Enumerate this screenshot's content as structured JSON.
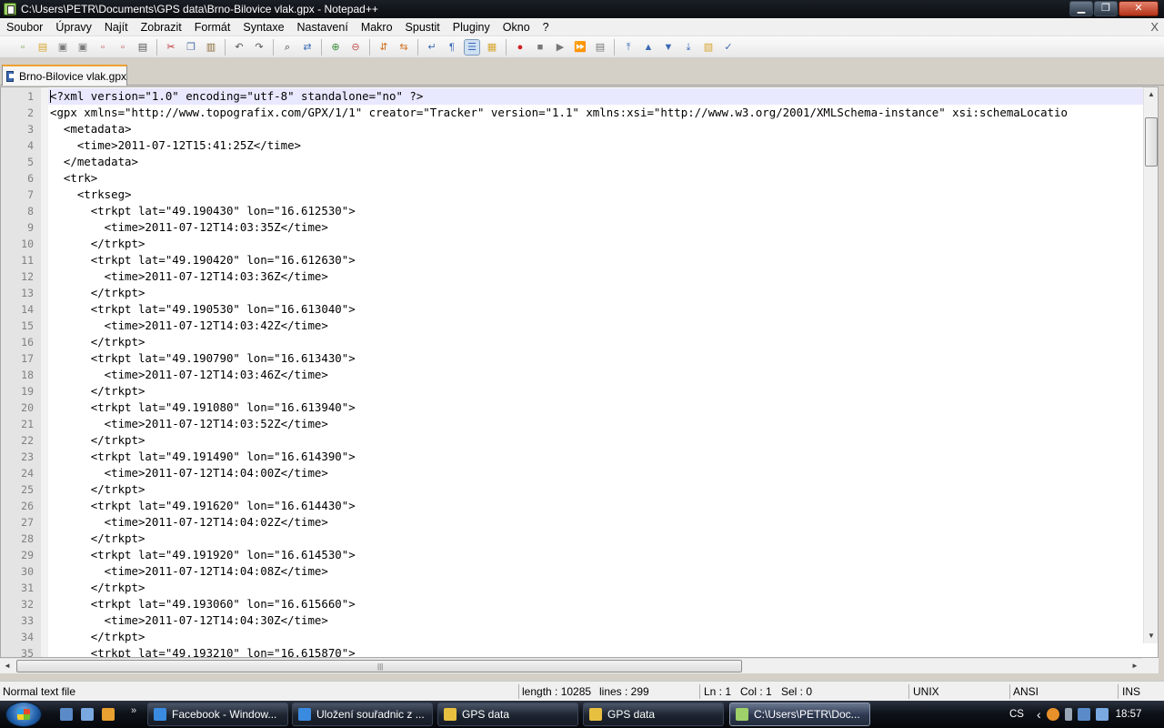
{
  "window": {
    "title": "C:\\Users\\PETR\\Documents\\GPS data\\Brno-Bilovice vlak.gpx - Notepad++",
    "app_icon": "notepadpp-icon",
    "buttons": {
      "minimize": "▁",
      "maximize": "❐",
      "close": "✕"
    }
  },
  "menu": {
    "items": [
      "Soubor",
      "Úpravy",
      "Najít",
      "Zobrazit",
      "Formát",
      "Syntaxe",
      "Nastavení",
      "Makro",
      "Spustit",
      "Pluginy",
      "Okno",
      "?"
    ],
    "close_glyph": "X"
  },
  "toolbar": {
    "icons": [
      {
        "name": "new-file-icon",
        "glyph": "▫",
        "color": "#6a9b3a"
      },
      {
        "name": "open-file-icon",
        "glyph": "▤",
        "color": "#d8a630"
      },
      {
        "name": "save-icon",
        "glyph": "▣",
        "color": "#7a7a7a"
      },
      {
        "name": "save-all-icon",
        "glyph": "▣",
        "color": "#7a7a7a"
      },
      {
        "name": "close-file-icon",
        "glyph": "▫",
        "color": "#c05050"
      },
      {
        "name": "close-all-icon",
        "glyph": "▫",
        "color": "#c05050"
      },
      {
        "name": "print-icon",
        "glyph": "▤",
        "color": "#555555"
      },
      {
        "sep": true
      },
      {
        "name": "cut-icon",
        "glyph": "✂",
        "color": "#c03030"
      },
      {
        "name": "copy-icon",
        "glyph": "❐",
        "color": "#4a6fa5"
      },
      {
        "name": "paste-icon",
        "glyph": "▥",
        "color": "#8a6a3a"
      },
      {
        "sep": true
      },
      {
        "name": "undo-icon",
        "glyph": "↶",
        "color": "#555555"
      },
      {
        "name": "redo-icon",
        "glyph": "↷",
        "color": "#555555"
      },
      {
        "sep": true
      },
      {
        "name": "find-icon",
        "glyph": "⌕",
        "color": "#333333"
      },
      {
        "name": "replace-icon",
        "glyph": "⇄",
        "color": "#3a6ab5"
      },
      {
        "sep": true
      },
      {
        "name": "zoom-in-icon",
        "glyph": "⊕",
        "color": "#3a8a3a"
      },
      {
        "name": "zoom-out-icon",
        "glyph": "⊖",
        "color": "#c05050"
      },
      {
        "sep": true
      },
      {
        "name": "sync-vertical-icon",
        "glyph": "⇵",
        "color": "#d07020"
      },
      {
        "name": "sync-horizontal-icon",
        "glyph": "⇆",
        "color": "#d07020"
      },
      {
        "sep": true
      },
      {
        "name": "word-wrap-icon",
        "glyph": "↵",
        "color": "#3a6ab5"
      },
      {
        "name": "show-all-chars-icon",
        "glyph": "¶",
        "color": "#3a6ab5"
      },
      {
        "name": "indent-guide-icon",
        "glyph": "☰",
        "color": "#3a6ab5",
        "pressed": true
      },
      {
        "name": "user-language-icon",
        "glyph": "▦",
        "color": "#d8a630"
      },
      {
        "sep": true
      },
      {
        "name": "record-macro-icon",
        "glyph": "●",
        "color": "#d02020"
      },
      {
        "name": "stop-macro-icon",
        "glyph": "■",
        "color": "#777777"
      },
      {
        "name": "play-macro-icon",
        "glyph": "▶",
        "color": "#777777"
      },
      {
        "name": "play-macro-multiple-icon",
        "glyph": "⏩",
        "color": "#3a6ab5"
      },
      {
        "name": "save-macro-icon",
        "glyph": "▤",
        "color": "#777777"
      },
      {
        "sep": true
      },
      {
        "name": "go-top-icon",
        "glyph": "⤒",
        "color": "#3a6ab5"
      },
      {
        "name": "go-up-icon",
        "glyph": "▲",
        "color": "#3a6ab5"
      },
      {
        "name": "go-down-icon",
        "glyph": "▼",
        "color": "#3a6ab5"
      },
      {
        "name": "go-bottom-icon",
        "glyph": "⤓",
        "color": "#3a6ab5"
      },
      {
        "name": "plugin-icon",
        "glyph": "▧",
        "color": "#d8a630"
      },
      {
        "name": "spell-check-icon",
        "glyph": "✓",
        "color": "#3a6ab5"
      }
    ]
  },
  "tab": {
    "label": "Brno-Bilovice vlak.gpx",
    "icon": "file-tab-icon"
  },
  "editor": {
    "active_line": 1,
    "lines": [
      {
        "n": "1",
        "text": "<?xml version=\"1.0\" encoding=\"utf-8\" standalone=\"no\" ?>"
      },
      {
        "n": "2",
        "text": "<gpx xmlns=\"http://www.topografix.com/GPX/1/1\" creator=\"Tracker\" version=\"1.1\" xmlns:xsi=\"http://www.w3.org/2001/XMLSchema-instance\" xsi:schemaLocatio"
      },
      {
        "n": "3",
        "text": "  <metadata>"
      },
      {
        "n": "4",
        "text": "    <time>2011-07-12T15:41:25Z</time>"
      },
      {
        "n": "5",
        "text": "  </metadata>"
      },
      {
        "n": "6",
        "text": "  <trk>"
      },
      {
        "n": "7",
        "text": "    <trkseg>"
      },
      {
        "n": "8",
        "text": "      <trkpt lat=\"49.190430\" lon=\"16.612530\">"
      },
      {
        "n": "9",
        "text": "        <time>2011-07-12T14:03:35Z</time>"
      },
      {
        "n": "10",
        "text": "      </trkpt>"
      },
      {
        "n": "11",
        "text": "      <trkpt lat=\"49.190420\" lon=\"16.612630\">"
      },
      {
        "n": "12",
        "text": "        <time>2011-07-12T14:03:36Z</time>"
      },
      {
        "n": "13",
        "text": "      </trkpt>"
      },
      {
        "n": "14",
        "text": "      <trkpt lat=\"49.190530\" lon=\"16.613040\">"
      },
      {
        "n": "15",
        "text": "        <time>2011-07-12T14:03:42Z</time>"
      },
      {
        "n": "16",
        "text": "      </trkpt>"
      },
      {
        "n": "17",
        "text": "      <trkpt lat=\"49.190790\" lon=\"16.613430\">"
      },
      {
        "n": "18",
        "text": "        <time>2011-07-12T14:03:46Z</time>"
      },
      {
        "n": "19",
        "text": "      </trkpt>"
      },
      {
        "n": "20",
        "text": "      <trkpt lat=\"49.191080\" lon=\"16.613940\">"
      },
      {
        "n": "21",
        "text": "        <time>2011-07-12T14:03:52Z</time>"
      },
      {
        "n": "22",
        "text": "      </trkpt>"
      },
      {
        "n": "23",
        "text": "      <trkpt lat=\"49.191490\" lon=\"16.614390\">"
      },
      {
        "n": "24",
        "text": "        <time>2011-07-12T14:04:00Z</time>"
      },
      {
        "n": "25",
        "text": "      </trkpt>"
      },
      {
        "n": "26",
        "text": "      <trkpt lat=\"49.191620\" lon=\"16.614430\">"
      },
      {
        "n": "27",
        "text": "        <time>2011-07-12T14:04:02Z</time>"
      },
      {
        "n": "28",
        "text": "      </trkpt>"
      },
      {
        "n": "29",
        "text": "      <trkpt lat=\"49.191920\" lon=\"16.614530\">"
      },
      {
        "n": "30",
        "text": "        <time>2011-07-12T14:04:08Z</time>"
      },
      {
        "n": "31",
        "text": "      </trkpt>"
      },
      {
        "n": "32",
        "text": "      <trkpt lat=\"49.193060\" lon=\"16.615660\">"
      },
      {
        "n": "33",
        "text": "        <time>2011-07-12T14:04:30Z</time>"
      },
      {
        "n": "34",
        "text": "      </trkpt>"
      },
      {
        "n": "35",
        "text": "      <trkpt lat=\"49.193210\" lon=\"16.615870\">"
      }
    ],
    "scroll": {
      "up": "▲",
      "down": "▼",
      "left": "◄",
      "right": "►",
      "grip": "|||"
    }
  },
  "statusbar": {
    "file_type": "Normal text file",
    "length": "length : 10285",
    "lines": "lines : 299",
    "ln": "Ln : 1",
    "col": "Col : 1",
    "sel": "Sel : 0",
    "eol": "UNIX",
    "encoding": "ANSI",
    "mode": "INS"
  },
  "taskbar": {
    "more": "»",
    "quick_launch": [
      {
        "name": "show-desktop-icon",
        "color": "#5a8ac8"
      },
      {
        "name": "switch-windows-icon",
        "color": "#7aa8e0"
      },
      {
        "name": "media-player-icon",
        "color": "#e8a030"
      }
    ],
    "buttons": [
      {
        "label": "Facebook - Window...",
        "icon": "ie-icon",
        "color": "#3a8ae0",
        "active": false
      },
      {
        "label": "Uložení souřadnic z ...",
        "icon": "ie-icon",
        "color": "#3a8ae0",
        "active": false
      },
      {
        "label": "GPS data",
        "icon": "folder-icon",
        "color": "#e8c040",
        "active": false
      },
      {
        "label": "GPS data",
        "icon": "folder-icon",
        "color": "#e8c040",
        "active": false
      },
      {
        "label": "C:\\Users\\PETR\\Doc...",
        "icon": "notepadpp-icon",
        "color": "#9fd16a",
        "active": true
      }
    ],
    "tray": {
      "language": "CS",
      "chevron": "‹",
      "clock": "18:57"
    }
  },
  "colors": {
    "active_line_bg": "#e8e8ff",
    "tab_accent": "#f0a030",
    "gutter_bg": "#e4e4e4"
  }
}
